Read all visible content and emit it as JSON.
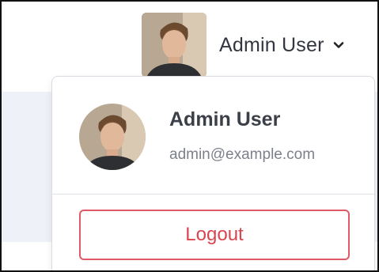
{
  "header": {
    "user_name": "Admin User",
    "avatar_icon": "avatar-photo",
    "chevron_icon": "chevron-down-icon"
  },
  "dropdown": {
    "name": "Admin User",
    "email": "admin@example.com",
    "logout_label": "Logout"
  },
  "colors": {
    "danger": "#d9444f",
    "text_dark": "#3b3f48",
    "text_muted": "#7c808a",
    "page_bg": "#eef2f8"
  }
}
